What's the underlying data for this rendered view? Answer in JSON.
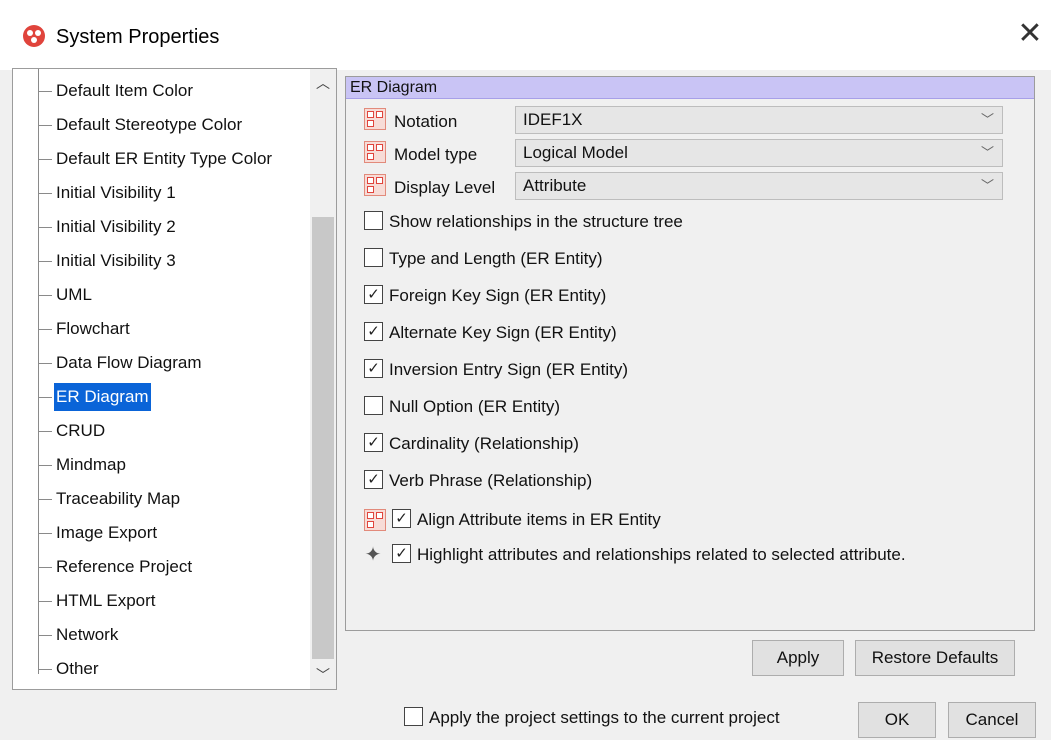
{
  "window": {
    "title": "System Properties",
    "close_glyph": "✕"
  },
  "tree": {
    "items": [
      "Default Item Color",
      "Default Stereotype Color",
      "Default ER Entity Type Color",
      "Initial Visibility 1",
      "Initial Visibility 2",
      "Initial Visibility 3",
      "UML",
      "Flowchart",
      "Data Flow Diagram",
      "ER Diagram",
      "CRUD",
      "Mindmap",
      "Traceability Map",
      "Image Export",
      "Reference Project",
      "HTML Export",
      "Network",
      "Other"
    ],
    "selected": "ER Diagram"
  },
  "panel": {
    "header": "ER Diagram",
    "notation": {
      "label": "Notation",
      "value": "IDEF1X"
    },
    "model_type": {
      "label": "Model type",
      "value": "Logical Model"
    },
    "display_level": {
      "label": "Display Level",
      "value": "Attribute"
    },
    "checkboxes": [
      {
        "label": "Show relationships in the structure tree",
        "checked": false
      },
      {
        "label": "Type and Length (ER Entity)",
        "checked": false
      },
      {
        "label": "Foreign Key Sign (ER Entity)",
        "checked": true
      },
      {
        "label": "Alternate Key Sign (ER Entity)",
        "checked": true
      },
      {
        "label": "Inversion Entry Sign (ER Entity)",
        "checked": true
      },
      {
        "label": "Null Option (ER Entity)",
        "checked": false
      },
      {
        "label": "Cardinality (Relationship)",
        "checked": true
      },
      {
        "label": "Verb Phrase (Relationship)",
        "checked": true
      }
    ],
    "align_attribute": {
      "label": "Align Attribute items in ER Entity",
      "checked": true
    },
    "highlight": {
      "label": "Highlight attributes and relationships related to selected attribute.",
      "checked": true
    }
  },
  "buttons": {
    "apply": "Apply",
    "restore_defaults": "Restore Defaults",
    "ok": "OK",
    "cancel": "Cancel"
  },
  "footer": {
    "apply_project_label": "Apply the project settings to the current project",
    "apply_project_checked": false
  },
  "colors": {
    "selection": "#0a64d8",
    "header_band": "#c9c4f5",
    "icon_red": "#e0443c"
  }
}
